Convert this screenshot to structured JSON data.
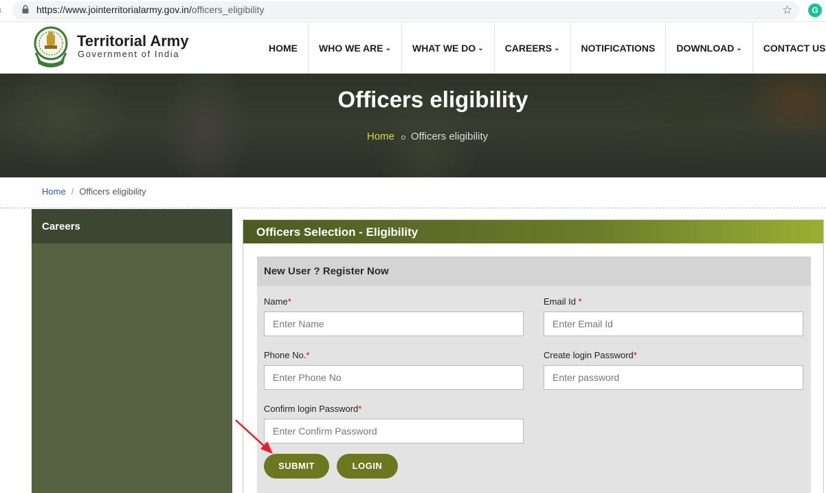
{
  "browser": {
    "url_host": "https://www.jointerritorialarmy.gov.in/",
    "url_path": "officers_eligibility",
    "ext_label": "G"
  },
  "header": {
    "title": "Territorial Army",
    "subtitle": "Government of India",
    "nav": [
      {
        "label": "HOME",
        "dropdown": false
      },
      {
        "label": "WHO WE ARE",
        "dropdown": true
      },
      {
        "label": "WHAT WE DO",
        "dropdown": true
      },
      {
        "label": "CAREERS",
        "dropdown": true
      },
      {
        "label": "NOTIFICATIONS",
        "dropdown": false
      },
      {
        "label": "DOWNLOAD",
        "dropdown": true
      },
      {
        "label": "CONTACT US",
        "dropdown": false
      }
    ]
  },
  "hero": {
    "title": "Officers eligibility",
    "crumb_home": "Home",
    "crumb_current": "Officers eligibility"
  },
  "breadcrumb": {
    "home": "Home",
    "separator": "/",
    "current": "Officers eligibility"
  },
  "sidebar": {
    "heading": "Careers"
  },
  "panel": {
    "title": "Officers Selection - Eligibility",
    "form_title": "New User ? Register Now",
    "fields": {
      "name": {
        "label": "Name",
        "required": "*",
        "placeholder": "Enter Name"
      },
      "email": {
        "label": "Email Id ",
        "required": "*",
        "placeholder": "Enter Email Id"
      },
      "phone": {
        "label": "Phone No.",
        "required": "*",
        "placeholder": "Enter Phone No"
      },
      "password": {
        "label": "Create login Password",
        "required": "*",
        "placeholder": "Enter password"
      },
      "confirm": {
        "label": "Confirm login Password",
        "required": "*",
        "placeholder": "Enter Confirm Password"
      }
    },
    "submit_label": "SUBMIT",
    "login_label": "LOGIN"
  },
  "colors": {
    "olive_button": "#6b781f",
    "sidebar": "#566141",
    "sidebar_head": "#3d4630",
    "annotation_arrow": "#e0202a"
  },
  "icons": [
    "back-icon",
    "lock-icon",
    "star-icon",
    "grammarly-icon",
    "emblem-icon",
    "chevron-down-icon",
    "annotation-arrow"
  ]
}
